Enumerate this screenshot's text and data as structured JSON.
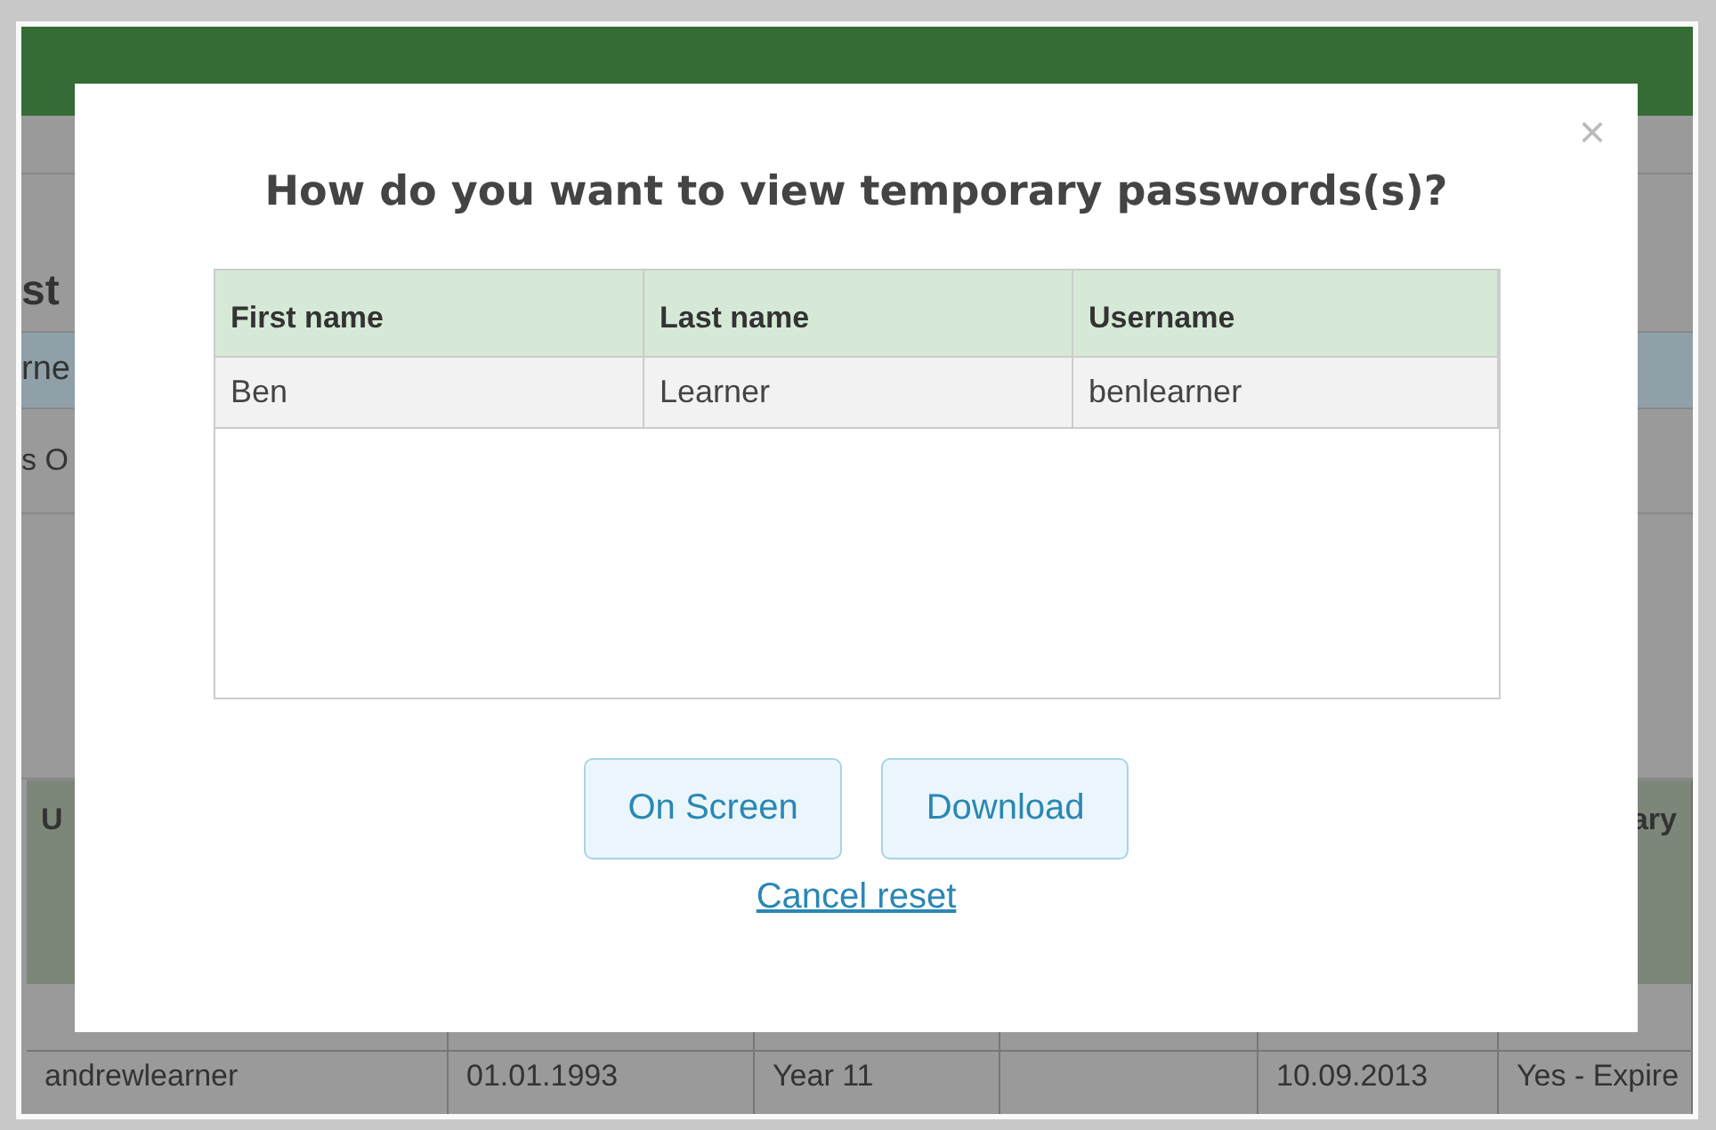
{
  "page": {
    "heading_fragment": "st",
    "field_fragment": "rne",
    "option_fragment": "s O",
    "table": {
      "columns": [
        "U",
        null,
        null,
        null,
        null,
        "ary"
      ],
      "rows": [
        [
          null,
          null,
          null,
          null,
          null,
          null
        ],
        [
          "andrewlearner",
          "01.01.1993",
          "Year 11",
          null,
          "10.09.2013",
          "Yes - Expire"
        ]
      ]
    }
  },
  "dialog": {
    "title": "How do you want to view temporary passwords(s)?",
    "close": "×",
    "table": {
      "columns": [
        "First name",
        "Last name",
        "Username"
      ],
      "rows": [
        [
          "Ben",
          "Learner",
          "benlearner"
        ]
      ]
    },
    "buttons": [
      "On Screen",
      "Download"
    ],
    "link": "Cancel reset"
  }
}
